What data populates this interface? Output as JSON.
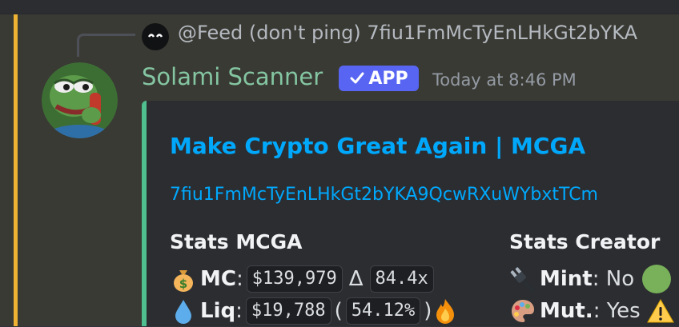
{
  "reply": {
    "text": "@Feed (don't ping) 7fiu1FmMcTyEnLHkGt2bYKA",
    "avatar_icon": "black-smiley-avatar-icon"
  },
  "author": {
    "name": "Solami Scanner",
    "badge": "APP",
    "badge_icon": "checkmark-icon",
    "timestamp": "Today at 8:46 PM",
    "avatar_icon": "frog-avatar-icon"
  },
  "embed": {
    "title": "Make Crypto Great Again | MCGA",
    "link": "7fiu1FmMcTyEnLHkGt2bYKA9QcwRXuWYbxtTCm",
    "accent_color": "#4fbf8f",
    "stats": {
      "name": "Stats MCGA",
      "mc": {
        "icon": "money-bag-icon",
        "label": "MC",
        "value": "$139,979",
        "delta_symbol": "Δ",
        "delta": "84.4x"
      },
      "liq": {
        "icon": "droplet-icon",
        "label": "Liq",
        "value": "$19,788",
        "pct": "54.12%",
        "status_icon": "fire-icon"
      }
    },
    "creator": {
      "name": "Stats Creator",
      "mint": {
        "icon": "plug-icon",
        "label": "Mint",
        "value": "No",
        "status_icon": "green-circle-icon"
      },
      "mut": {
        "icon": "palette-icon",
        "label": "Mut.",
        "value": "Yes",
        "status_icon": "warning-icon"
      }
    }
  },
  "colors": {
    "background": "#313338",
    "message_highlight": "#3a3a34",
    "mention_bar": "#f0b232",
    "author_name": "#84c6a2",
    "app_badge": "#5865f2",
    "link": "#00a8fc"
  }
}
